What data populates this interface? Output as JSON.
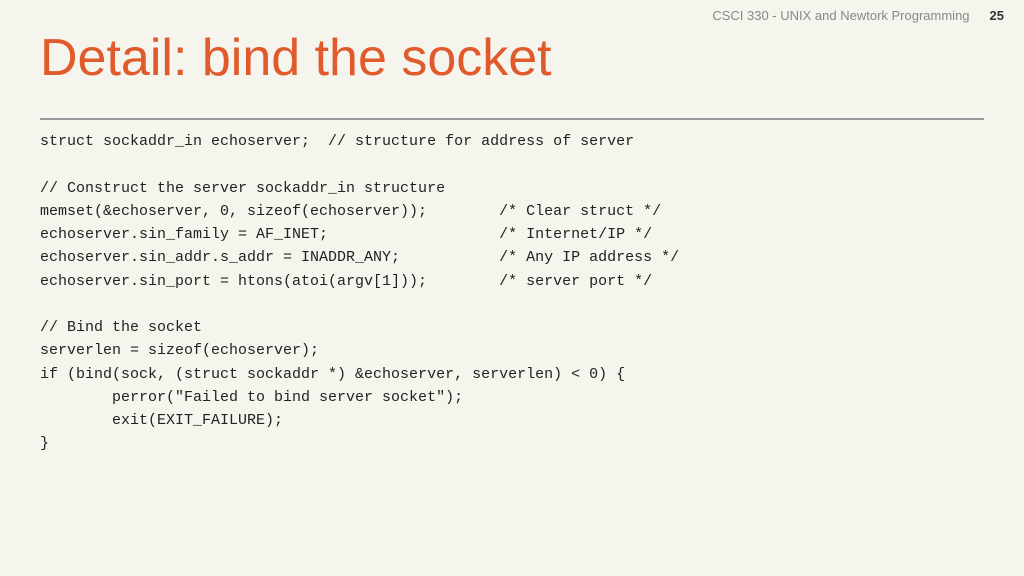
{
  "header": {
    "course_title": "CSCI 330 - UNIX and Newtork Programming",
    "slide_number": "25"
  },
  "slide": {
    "title": "Detail: bind the socket"
  },
  "code": {
    "lines": [
      "struct sockaddr_in echoserver;  // structure for address of server",
      "",
      "// Construct the server sockaddr_in structure",
      "memset(&echoserver, 0, sizeof(echoserver));        /* Clear struct */",
      "echoserver.sin_family = AF_INET;                   /* Internet/IP */",
      "echoserver.sin_addr.s_addr = INADDR_ANY;           /* Any IP address */",
      "echoserver.sin_port = htons(atoi(argv[1]));        /* server port */",
      "",
      "// Bind the socket",
      "serverlen = sizeof(echoserver);",
      "if (bind(sock, (struct sockaddr *) &echoserver, serverlen) < 0) {",
      "        perror(\"Failed to bind server socket\");",
      "        exit(EXIT_FAILURE);",
      "}"
    ]
  }
}
